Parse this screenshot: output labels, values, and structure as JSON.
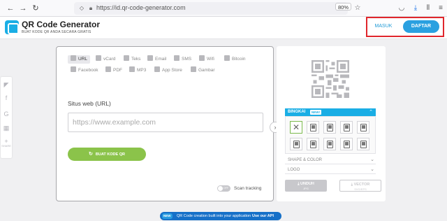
{
  "browser": {
    "url": "https://id.qr-code-generator.com",
    "zoom": "80%",
    "nav_icons": [
      "back-icon",
      "forward-icon",
      "reload-icon"
    ],
    "toolbar_icons": [
      "pocket-icon",
      "download-icon",
      "library-icon",
      "menu-icon"
    ]
  },
  "header": {
    "title": "QR Code Generator",
    "subtitle": "BUAT KODE QR ANDA SECARA GRATIS",
    "login": "MASUK",
    "signup": "DAFTAR"
  },
  "social": {
    "icons": [
      "twitter-icon",
      "facebook-icon",
      "google-icon",
      "print-icon",
      "share-plus-icon"
    ],
    "count_label": "SHARE"
  },
  "tabs": [
    {
      "label": "URL",
      "icon": "link-icon",
      "active": true
    },
    {
      "label": "vCard",
      "icon": "vcard-icon"
    },
    {
      "label": "Teks",
      "icon": "text-icon"
    },
    {
      "label": "Email",
      "icon": "email-icon"
    },
    {
      "label": "SMS",
      "icon": "sms-icon"
    },
    {
      "label": "Wifi",
      "icon": "wifi-icon"
    },
    {
      "label": "Bitcoin",
      "icon": "bitcoin-icon"
    },
    {
      "label": "Facebook",
      "icon": "facebook-icon"
    },
    {
      "label": "PDF",
      "icon": "pdf-icon"
    },
    {
      "label": "MP3",
      "icon": "mp3-icon"
    },
    {
      "label": "App Store",
      "icon": "appstore-icon"
    },
    {
      "label": "Gambar",
      "icon": "image-icon"
    }
  ],
  "form": {
    "label": "Situs web (URL)",
    "placeholder": "https://www.example.com",
    "generate": "BUAT KODE QR",
    "scan_toggle": "OFF",
    "scan_label": "Scan tracking"
  },
  "right": {
    "frame_title": "BINGKAI",
    "frame_badge": "NEW!",
    "shape_color": "SHAPE & COLOR",
    "logo": "LOGO",
    "download": "UNDUH",
    "download_sub": "JPG",
    "vector": "VECTOR",
    "vector_sub": "SVG/EPS"
  },
  "api": {
    "badge": "NEW",
    "text": "QR Code creation built into your application",
    "link": "Use our API"
  }
}
